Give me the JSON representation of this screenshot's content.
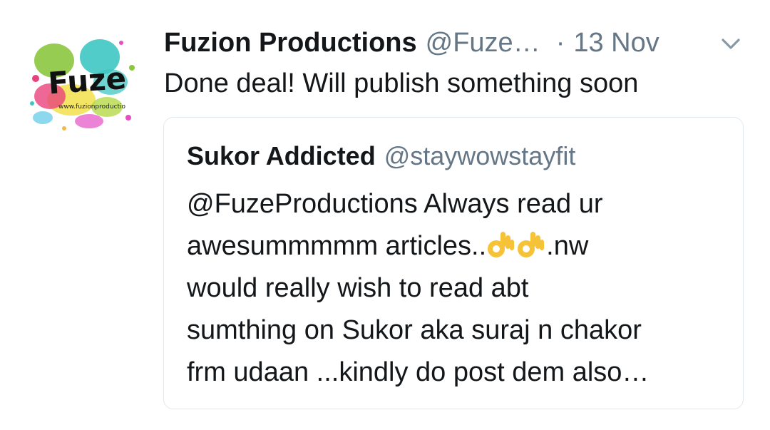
{
  "tweet": {
    "display_name": "Fuzion Productions",
    "handle": "@Fuze…",
    "separator": "·",
    "date": "13 Nov",
    "text": "Done deal! Will publish something soon",
    "menu_icon": "chevron-down-icon",
    "avatar": {
      "logo_text": "Fuze",
      "logo_subtext": "www.fuzionproductio"
    }
  },
  "quoted_tweet": {
    "display_name": "Sukor Addicted",
    "handle": "@staywowstayfit",
    "line1": "@FuzeProductions Always read ur",
    "line2_start": "awesummmmm articles..",
    "emoji": "ok-hand-emoji",
    "line2_end": ".nw",
    "line3": "would really wish to read abt",
    "line4": "sumthing on Sukor aka suraj n chakor",
    "line5": "frm udaan ...kindly do post dem also…"
  },
  "colors": {
    "text_primary": "#14171a",
    "text_secondary": "#657786",
    "card_border": "#e1e8ed"
  }
}
